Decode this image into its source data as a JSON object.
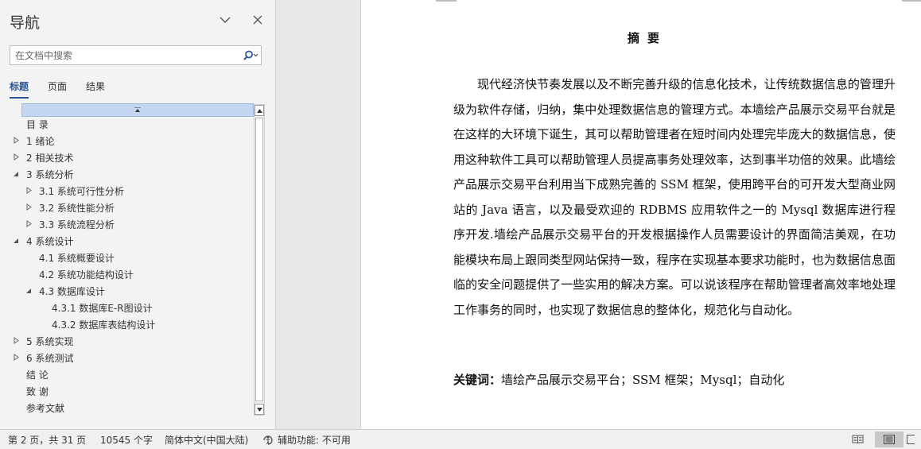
{
  "nav": {
    "title": "导航",
    "search_placeholder": "在文档中搜索",
    "tabs": [
      {
        "label": "标题",
        "active": true
      },
      {
        "label": "页面",
        "active": false
      },
      {
        "label": "结果",
        "active": false
      }
    ],
    "tree": [
      {
        "label": "目 录",
        "level": 0,
        "expandable": false,
        "expanded": false
      },
      {
        "label": "1 绪论",
        "level": 0,
        "expandable": true,
        "expanded": false
      },
      {
        "label": "2 相关技术",
        "level": 0,
        "expandable": true,
        "expanded": false
      },
      {
        "label": "3 系统分析",
        "level": 0,
        "expandable": true,
        "expanded": true
      },
      {
        "label": "3.1 系统可行性分析",
        "level": 1,
        "expandable": true,
        "expanded": false
      },
      {
        "label": "3.2 系统性能分析",
        "level": 1,
        "expandable": true,
        "expanded": false
      },
      {
        "label": "3.3 系统流程分析",
        "level": 1,
        "expandable": true,
        "expanded": false
      },
      {
        "label": "4 系统设计",
        "level": 0,
        "expandable": true,
        "expanded": true
      },
      {
        "label": "4.1 系统概要设计",
        "level": 1,
        "expandable": false,
        "expanded": false
      },
      {
        "label": "4.2 系统功能结构设计",
        "level": 1,
        "expandable": false,
        "expanded": false
      },
      {
        "label": "4.3 数据库设计",
        "level": 1,
        "expandable": true,
        "expanded": true
      },
      {
        "label": "4.3.1 数据库E-R图设计",
        "level": 2,
        "expandable": false,
        "expanded": false
      },
      {
        "label": "4.3.2 数据库表结构设计",
        "level": 2,
        "expandable": false,
        "expanded": false
      },
      {
        "label": "5 系统实现",
        "level": 0,
        "expandable": true,
        "expanded": false
      },
      {
        "label": "6 系统测试",
        "level": 0,
        "expandable": true,
        "expanded": false
      },
      {
        "label": "结 论",
        "level": 0,
        "expandable": false,
        "expanded": false
      },
      {
        "label": "致 谢",
        "level": 0,
        "expandable": false,
        "expanded": false
      },
      {
        "label": "参考文献",
        "level": 0,
        "expandable": false,
        "expanded": false
      }
    ]
  },
  "document": {
    "title": "摘要",
    "body": "现代经济快节奏发展以及不断完善升级的信息化技术，让传统数据信息的管理升级为软件存储，归纳，集中处理数据信息的管理方式。本墙绘产品展示交易平台就是在这样的大环境下诞生，其可以帮助管理者在短时间内处理完毕庞大的数据信息，使用这种软件工具可以帮助管理人员提高事务处理效率，达到事半功倍的效果。此墙绘产品展示交易平台利用当下成熟完善的 SSM 框架，使用跨平台的可开发大型商业网站的 Java 语言，以及最受欢迎的 RDBMS 应用软件之一的 Mysql 数据库进行程序开发.墙绘产品展示交易平台的开发根据操作人员需要设计的界面简洁美观，在功能模块布局上跟同类型网站保持一致，程序在实现基本要求功能时，也为数据信息面临的安全问题提供了一些实用的解决方案。可以说该程序在帮助管理者高效率地处理工作事务的同时，也实现了数据信息的整体化，规范化与自动化。",
    "keywords_label": "关键词：",
    "keywords": "墙绘产品展示交易平台；SSM 框架；Mysql；自动化"
  },
  "status": {
    "page": "第 2 页，共 31 页",
    "words": "10545 个字",
    "language": "简体中文(中国大陆)",
    "accessibility": "辅助功能: 不可用"
  },
  "icons": {
    "collapse": "chevron-down-icon",
    "close": "close-icon",
    "search": "search-icon",
    "accessibility": "accessibility-icon",
    "read_mode": "read-mode-icon",
    "print_layout": "print-layout-icon",
    "web_layout": "web-layout-icon"
  },
  "colors": {
    "accent": "#2b5797",
    "tree_highlight": "#c5d7f0"
  }
}
